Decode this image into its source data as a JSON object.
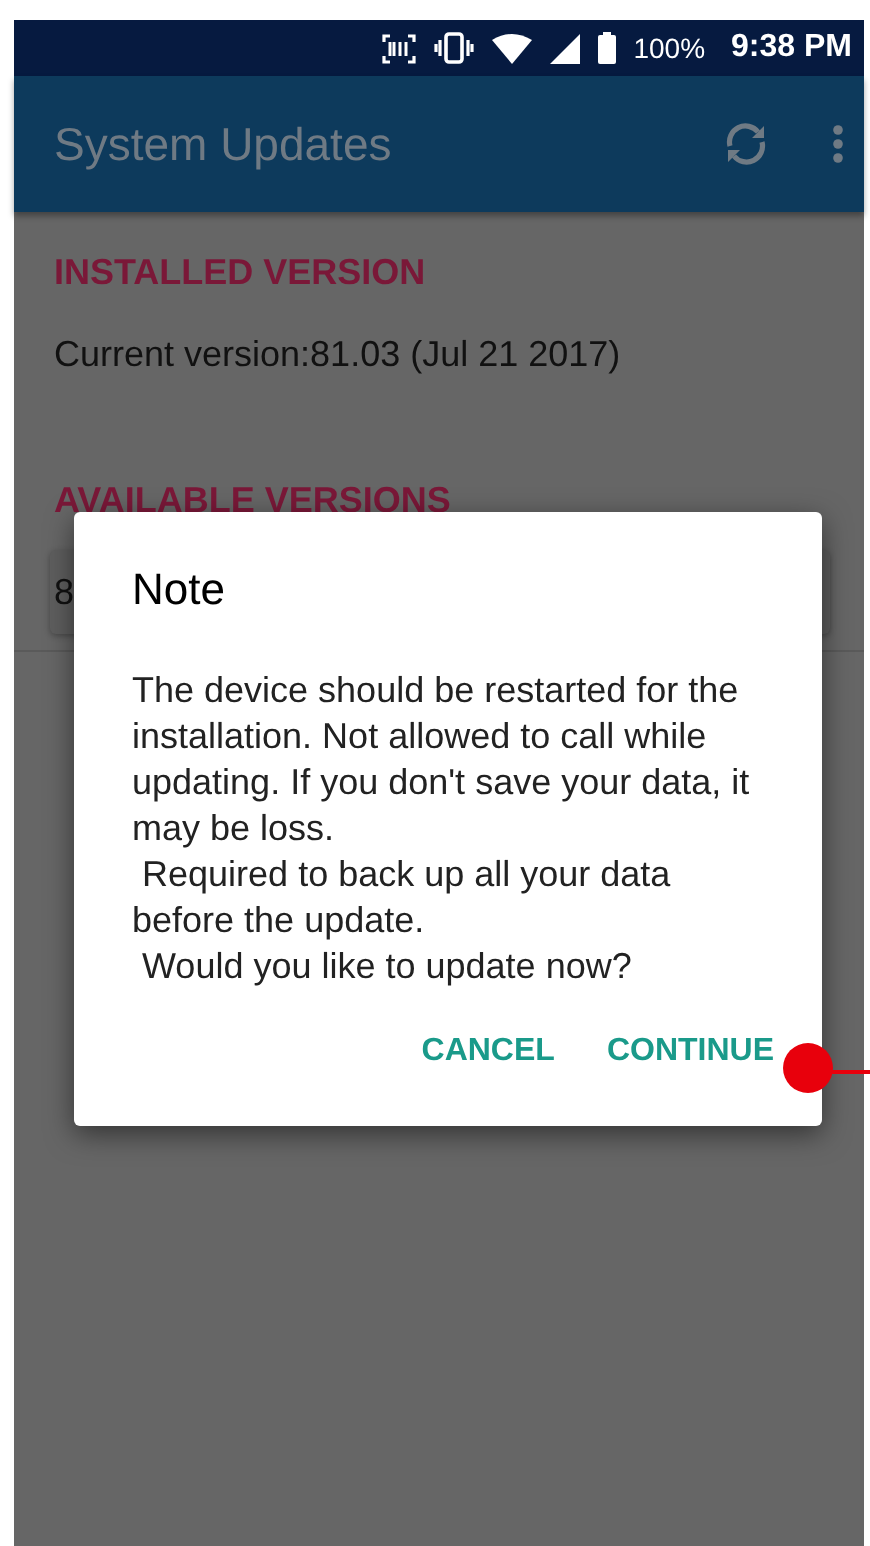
{
  "status_bar": {
    "battery": "100%",
    "time": "9:38 PM"
  },
  "app_bar": {
    "title": "System Updates"
  },
  "sections": [
    {
      "heading": "INSTALLED VERSION",
      "items": [
        {
          "kind": "text",
          "text": "Current version:81.03 (Jul 21 2017)"
        }
      ]
    },
    {
      "heading": "AVAILABLE VERSIONS",
      "items": [
        {
          "kind": "card",
          "text": "8"
        }
      ]
    }
  ],
  "dialog": {
    "title": "Note",
    "message": "The device should be restarted for the installation. Not allowed to call while updating. If you don't save your data, it may be loss.\n Required to back up all your data before the update.\n Would you like to update now?",
    "buttons": [
      "CANCEL",
      "CONTINUE"
    ]
  }
}
